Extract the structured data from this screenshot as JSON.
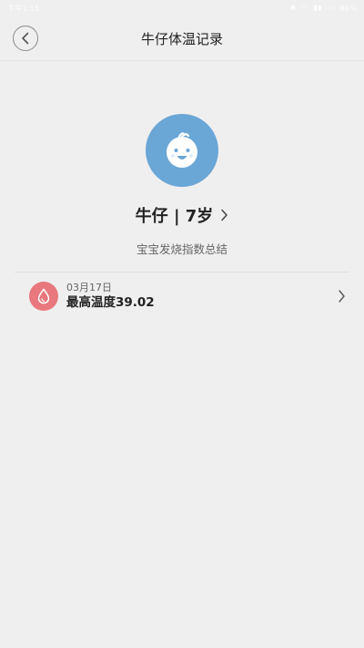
{
  "status_bar": {
    "time": "下午1:15",
    "battery": "86%"
  },
  "header": {
    "title": "牛仔体温记录"
  },
  "profile": {
    "name_age": "牛仔 | 7岁",
    "summary_label": "宝宝发烧指数总结"
  },
  "records": [
    {
      "date": "03月17日",
      "value": "最高温度39.02"
    }
  ],
  "colors": {
    "avatar_bg": "#6aa6d6",
    "record_icon_bg": "#e8787d",
    "page_bg": "#efefef"
  },
  "icons": {
    "back": "chevron-left-icon",
    "avatar": "baby-face-icon",
    "record": "drop-icon",
    "row_arrow": "chevron-right-icon"
  }
}
